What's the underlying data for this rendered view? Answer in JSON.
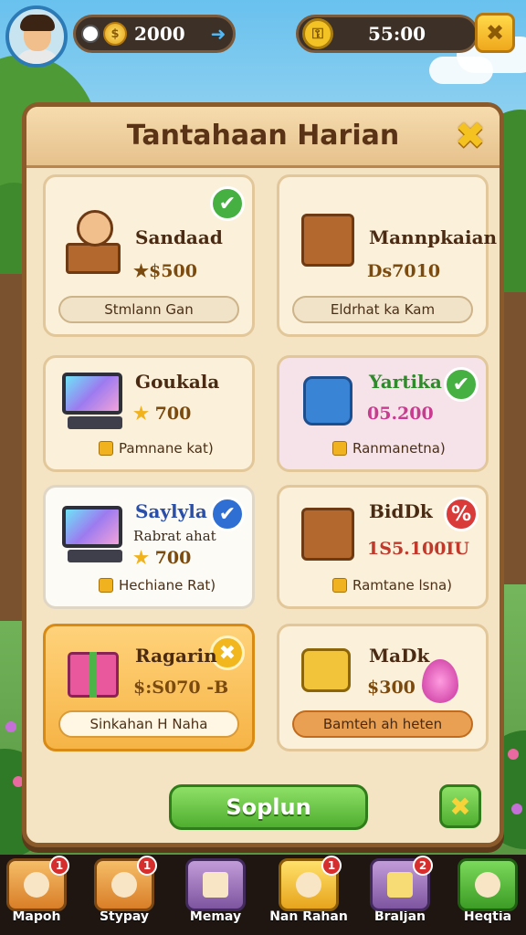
{
  "hud": {
    "currency_value": "2000",
    "timer_value": "55:00"
  },
  "panel": {
    "title": "Tantahaan Harian"
  },
  "cards": [
    {
      "name": "Sandaad",
      "reward": "★$500",
      "action": "Stmlann Gan",
      "status": "check"
    },
    {
      "name": "Mannpkaian",
      "reward": "Ds7010",
      "action": "Eldrhat ka Kam",
      "status": "none"
    },
    {
      "name": "Goukala",
      "reward": "700",
      "footer": "Pamnane kat)",
      "status": "none"
    },
    {
      "name": "Yartika",
      "reward": "05.200",
      "footer": "Ranmanetna)",
      "status": "check"
    },
    {
      "name": "Saylyla",
      "subtitle": "Rabrat ahat",
      "reward": "700",
      "footer": "Hechiane Rat)",
      "status": "check-blue"
    },
    {
      "name": "BidDk",
      "reward": "1S5.100IU",
      "footer": "Ramtane lsna)",
      "status": "percent"
    },
    {
      "name": "Ragarin",
      "reward": "$:S070 -B",
      "action": "Sinkahan H Naha",
      "status": "coin"
    },
    {
      "name": "MaDk",
      "reward": "$300",
      "action": "Bamteh ah heten",
      "status": "none"
    }
  ],
  "footer": {
    "primary_label": "Soplun"
  },
  "nav": [
    {
      "label": "Mapoh",
      "badge": "1"
    },
    {
      "label": "Stypay",
      "badge": "1"
    },
    {
      "label": "Memay",
      "badge": ""
    },
    {
      "label": "Nan Rahan",
      "badge": "1"
    },
    {
      "label": "Braljan",
      "badge": "2"
    },
    {
      "label": "Heqtia",
      "badge": ""
    }
  ]
}
